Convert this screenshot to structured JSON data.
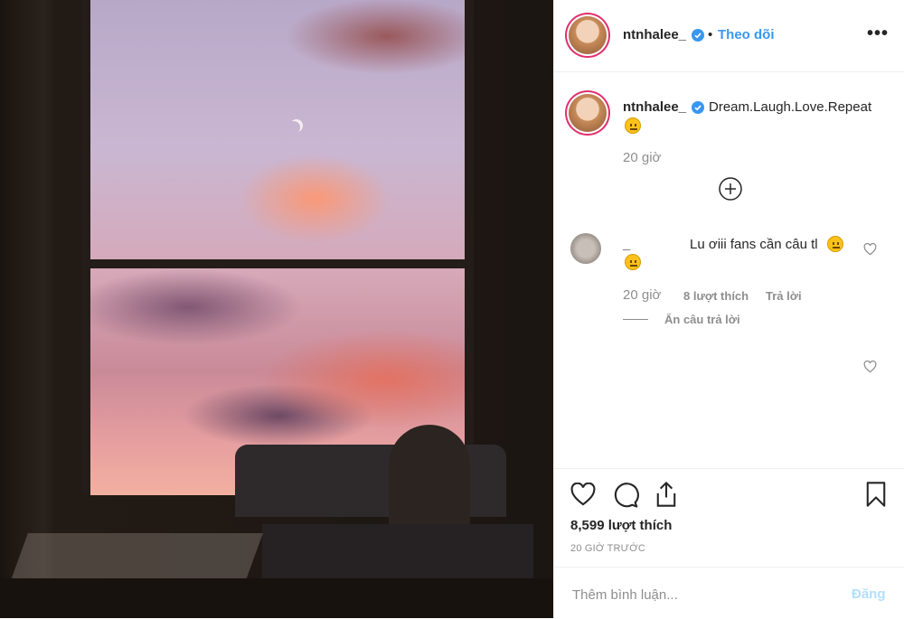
{
  "post": {
    "image_alt": "",
    "user": "ntnhalee_",
    "follow_label": "Theo dõi",
    "dot": "•",
    "more_icon": "more-dots-icon"
  },
  "caption": {
    "user": "ntnhalee_",
    "text": "Dream.Laugh.Love.Repeat",
    "emoji": "grimacing-face",
    "time": "20 giờ"
  },
  "comment": {
    "user": "_",
    "text": "Lu ơiii fans cần câu tl",
    "emoji": "unamused-face",
    "time": "20 giờ",
    "likes": "8 lượt thích",
    "reply_label": "Trả lời",
    "hide_replies_label": "Ẩn câu trả lời"
  },
  "stats": {
    "likes": "8,599 lượt thích",
    "time_ago": "20 GIỜ TRƯỚC"
  },
  "compose": {
    "placeholder": "Thêm bình luận...",
    "post_label": "Đăng"
  },
  "colors": {
    "link": "#3897f0",
    "verified": "#3897f0",
    "muted": "#8e8e8e",
    "post_disabled": "#b2dffc"
  }
}
